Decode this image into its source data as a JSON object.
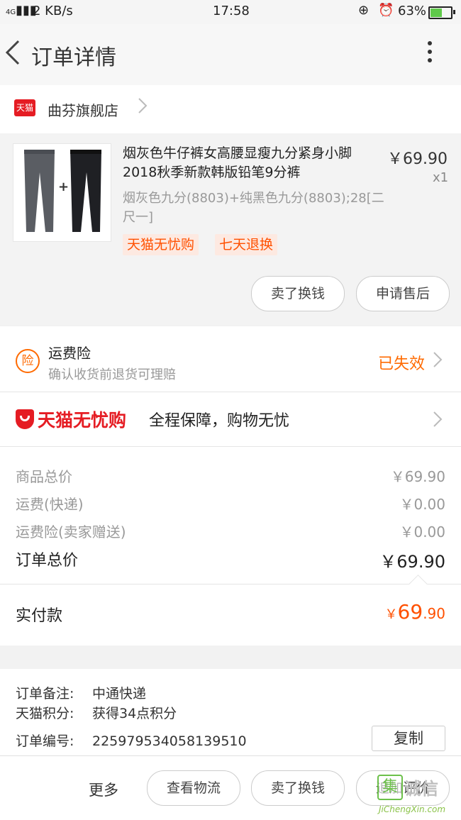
{
  "status_bar": {
    "network_type": "4G",
    "speed": "2 KB/s",
    "time": "17:58",
    "battery": "63%",
    "battery_level": 0.63,
    "icons": [
      "signal-icon",
      "lock-rotation-icon",
      "alarm-icon",
      "battery-icon"
    ]
  },
  "header": {
    "title": "订单详情",
    "back_icon": "chevron-left-icon",
    "more_icon": "more-vertical-icon"
  },
  "store": {
    "logo_text": "天猫",
    "name": "曲芬旗舰店"
  },
  "item": {
    "title": "烟灰色牛仔裤女高腰显瘦九分紧身小脚2018秋季新款韩版铅笔9分裤",
    "price": "￥69.90",
    "qty": "x1",
    "sku": "烟灰色九分(8803)+纯黑色九分(8803);28[二尺一]",
    "tags": [
      "天猫无忧购",
      "七天退换"
    ],
    "buttons": [
      "卖了换钱",
      "申请售后"
    ]
  },
  "insurance": {
    "icon_text": "险",
    "title": "运费险",
    "subtitle": "确认收货前退货可理赔",
    "status": "已失效"
  },
  "guarantee": {
    "brand": "天猫无忧购",
    "text": "全程保障，购物无忧"
  },
  "summary": {
    "rows": [
      {
        "label": "商品总价",
        "value": "￥69.90"
      },
      {
        "label": "运费(快递)",
        "value": "￥0.00"
      },
      {
        "label": "运费险(卖家赠送)",
        "value": "￥0.00"
      }
    ],
    "total_label": "订单总价",
    "total_value": "￥69.90",
    "paid_label": "实付款",
    "paid_symbol": "￥",
    "paid_int": "69",
    "paid_dec": ".90"
  },
  "notes": {
    "remark_label": "订单备注:",
    "remark_value": "中通快递",
    "points_label": "天猫积分:",
    "points_value": "获得34点积分",
    "order_no_label": "订单编号:",
    "order_no_value": "225979534058139510",
    "copy_label": "复制"
  },
  "bottom_bar": {
    "more": "更多",
    "buttons": [
      "查看物流",
      "卖了换钱",
      "追加评价"
    ]
  },
  "watermark": {
    "icon_text": "集",
    "text": "诚信",
    "url": "JiChengXin.com"
  },
  "colors": {
    "accent_orange": "#ff5000",
    "tmall_red": "#e51c23",
    "watermark_green": "#6cc04a"
  }
}
